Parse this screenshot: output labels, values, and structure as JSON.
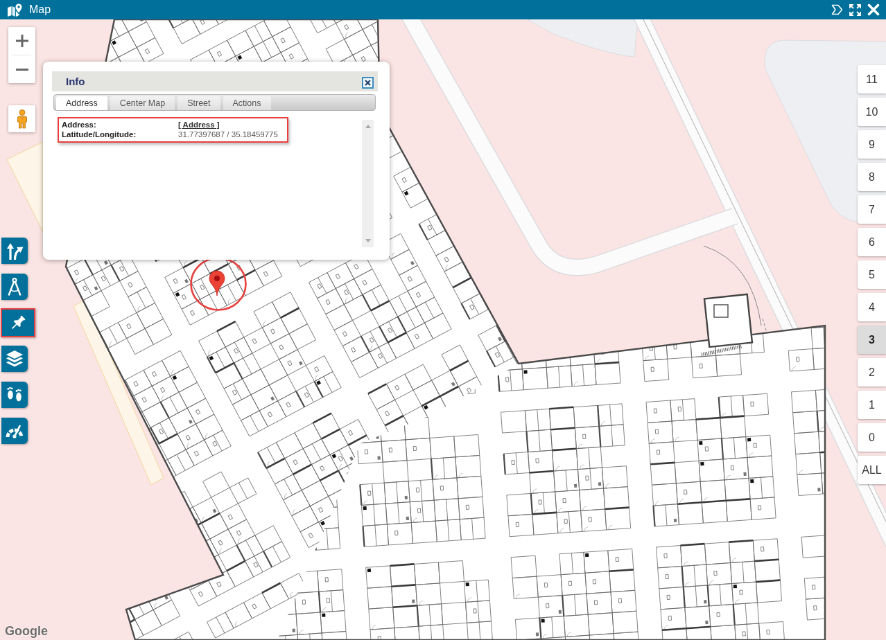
{
  "window": {
    "title": "Map"
  },
  "map": {
    "tools": [
      {
        "kind": "route",
        "highlighted": false
      },
      {
        "kind": "measure",
        "highlighted": false
      },
      {
        "kind": "pin",
        "highlighted": true
      },
      {
        "kind": "layers",
        "highlighted": false
      },
      {
        "kind": "footsteps",
        "highlighted": false
      },
      {
        "kind": "speed",
        "highlighted": false
      }
    ],
    "marker": {
      "highlighted": true
    },
    "floors": [
      {
        "label": "11",
        "selected": false
      },
      {
        "label": "10",
        "selected": false
      },
      {
        "label": "9",
        "selected": false
      },
      {
        "label": "8",
        "selected": false
      },
      {
        "label": "7",
        "selected": false
      },
      {
        "label": "6",
        "selected": false
      },
      {
        "label": "5",
        "selected": false
      },
      {
        "label": "4",
        "selected": false
      },
      {
        "label": "3",
        "selected": true
      },
      {
        "label": "2",
        "selected": false
      },
      {
        "label": "1",
        "selected": false
      },
      {
        "label": "0",
        "selected": false
      },
      {
        "label": "ALL",
        "selected": false
      }
    ],
    "attribution": "Google"
  },
  "info_window": {
    "title": "Info",
    "tabs": [
      {
        "label": "Address",
        "selected": true
      },
      {
        "label": "Center Map",
        "selected": false
      },
      {
        "label": "Street",
        "selected": false
      },
      {
        "label": "Actions",
        "selected": false
      }
    ],
    "highlighted": true,
    "rows": [
      {
        "label": "Address:",
        "value": "[ Address ]",
        "kind": "link"
      },
      {
        "label": "Latitude/Longitude:",
        "value": "31.77397687 / 35.18459775",
        "kind": "text"
      }
    ]
  }
}
